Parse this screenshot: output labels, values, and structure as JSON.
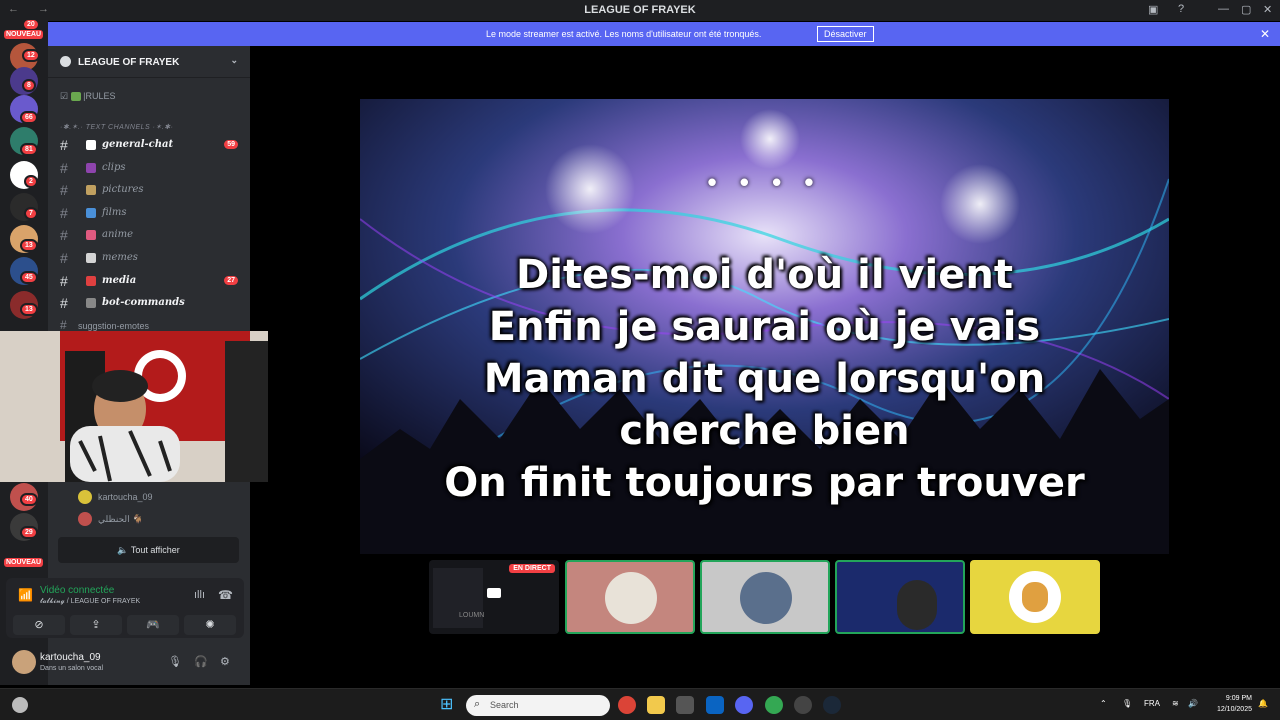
{
  "window": {
    "title": "LEAGUE OF FRAYEK",
    "nav": "← →"
  },
  "banner": {
    "message": "Le mode streamer est activé. Les noms d'utilisateur ont été tronqués.",
    "button": "Désactiver",
    "close": "✕"
  },
  "servers": {
    "badges": [
      "12",
      "8",
      "66",
      "81",
      "2",
      "7",
      "13",
      "45",
      "13",
      "40",
      "29"
    ],
    "top_badge": "20",
    "new_label": "NOUVEAU"
  },
  "guild": {
    "name": "LEAGUE OF FRAYEK",
    "chevron": "⌄"
  },
  "rules_channel": "|RULES",
  "category": "·✱.✶.· TEXT CHANNELS ·✶.✱·",
  "channels": [
    {
      "name": "general-chat",
      "badge": "59",
      "unread": true,
      "color": "#ffffff"
    },
    {
      "name": "clips",
      "badge": "",
      "unread": false,
      "color": "#8e44ad"
    },
    {
      "name": "pictures",
      "badge": "",
      "unread": false,
      "color": "#c0a060"
    },
    {
      "name": "films",
      "badge": "",
      "unread": false,
      "color": "#4a90d9"
    },
    {
      "name": "anime",
      "badge": "",
      "unread": false,
      "color": "#e05a80"
    },
    {
      "name": "memes",
      "badge": "",
      "unread": false,
      "color": "#d4d4d4"
    },
    {
      "name": "media",
      "badge": "27",
      "unread": true,
      "color": "#e04040"
    },
    {
      "name": "bot-commands",
      "badge": "",
      "unread": true,
      "color": "#888888"
    }
  ],
  "partial_channel": "suggstion-emotes",
  "voice_users": [
    {
      "name": "kartoucha_09",
      "color": "#d9c23a"
    },
    {
      "name": "الحنظلي 🐐",
      "color": "#c0504d"
    }
  ],
  "show_all": "Tout afficher",
  "rtc": {
    "state": "Vidéo connectée",
    "location": "𝓽𝓪𝓵𝓴𝓲𝓷𝓰 / LEAGUE OF FRAYEK"
  },
  "user": {
    "name": "kartoucha_09",
    "status": "Dans un salon vocal"
  },
  "stage": {
    "dots": "• • • •",
    "lyrics": [
      "Dites-moi d'où il vient",
      "Enfin je saurai où je vais",
      "Maman dit que lorsqu'on",
      "cherche bien",
      "On finit toujours par trouver"
    ]
  },
  "tiles": {
    "live_label": "EN DIRECT",
    "screen_text": "LOUMN"
  },
  "taskbar": {
    "search": "Search",
    "lang": "FRA",
    "time": "9:09 PM",
    "date": "12/10/2025"
  }
}
